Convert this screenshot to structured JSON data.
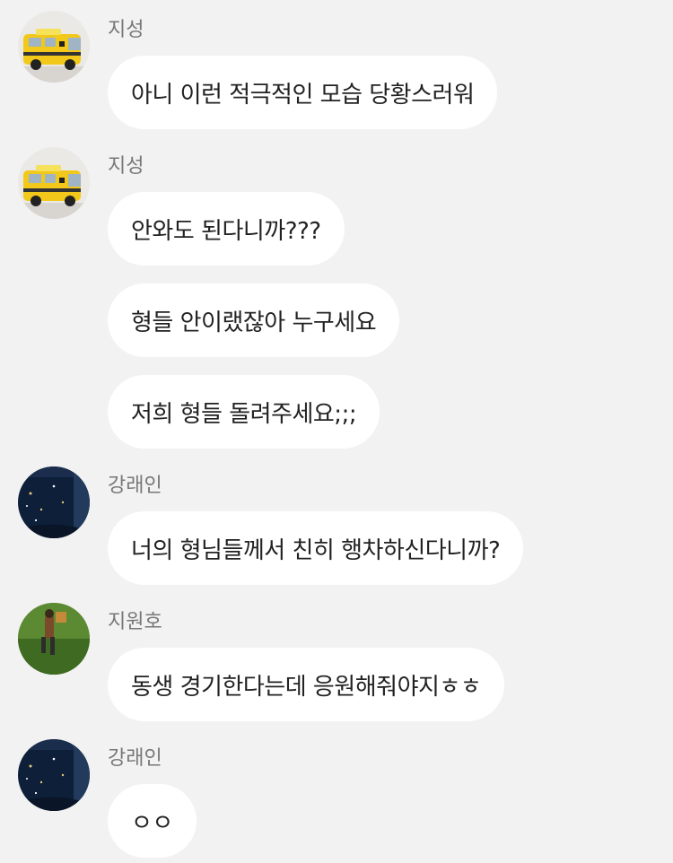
{
  "messages": [
    {
      "sender": "지성",
      "avatar": "ambulance-toy-photo",
      "bubbles": [
        "아니 이런 적극적인 모습 당황스러워"
      ]
    },
    {
      "sender": "지성",
      "avatar": "ambulance-toy-photo",
      "bubbles": [
        "안와도 된다니까???",
        "형들 안이랬잖아 누구세요",
        "저희 형들 돌려주세요;;;"
      ]
    },
    {
      "sender": "강래인",
      "avatar": "night-sky-window-photo",
      "bubbles": [
        "너의 형님들께서 친히 행차하신다니까?"
      ]
    },
    {
      "sender": "지원호",
      "avatar": "person-lying-on-grass-photo",
      "bubbles": [
        "동생 경기한다는데 응원해줘야지ㅎㅎ"
      ]
    },
    {
      "sender": "강래인",
      "avatar": "night-sky-window-photo",
      "bubbles": [
        "ㅇㅇ"
      ]
    }
  ],
  "colors": {
    "background": "#f2f2f2",
    "bubble": "#ffffff",
    "sender_name": "#777777",
    "message_text": "#222222"
  }
}
